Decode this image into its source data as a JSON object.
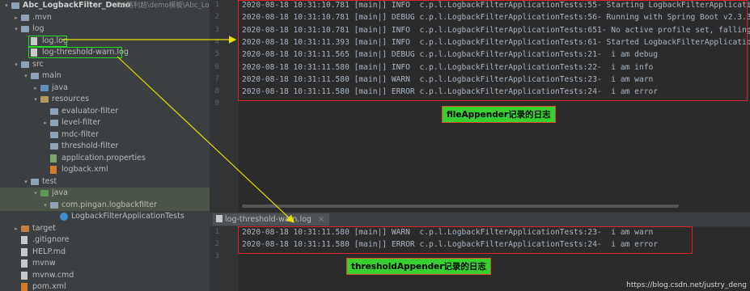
{
  "tree": {
    "items": [
      {
        "label": "Abc_LogbackFilter_Demo",
        "path": "D:\\路利超\\demo模板\\Abc_Lo",
        "bold": true,
        "depth": 0,
        "arrow": "▾",
        "icon": "folder"
      },
      {
        "label": ".mvn",
        "depth": 1,
        "arrow": "▸",
        "icon": "folder"
      },
      {
        "label": "log",
        "depth": 1,
        "arrow": "▾",
        "icon": "folder"
      },
      {
        "label": "log.log",
        "depth": 2,
        "arrow": "",
        "icon": "file",
        "boxed": true
      },
      {
        "label": "log-threshold-warn.log",
        "depth": 2,
        "arrow": "",
        "icon": "file",
        "boxed": true
      },
      {
        "label": "src",
        "depth": 1,
        "arrow": "▾",
        "icon": "folder"
      },
      {
        "label": "main",
        "depth": 2,
        "arrow": "▾",
        "icon": "folder"
      },
      {
        "label": "java",
        "depth": 3,
        "arrow": "▸",
        "icon": "folder-src"
      },
      {
        "label": "resources",
        "depth": 3,
        "arrow": "▾",
        "icon": "folder-res"
      },
      {
        "label": "evaluator-filter",
        "depth": 4,
        "arrow": "",
        "icon": "folder"
      },
      {
        "label": "level-filter",
        "depth": 4,
        "arrow": "▸",
        "icon": "folder"
      },
      {
        "label": "mdc-filter",
        "depth": 4,
        "arrow": "",
        "icon": "folder"
      },
      {
        "label": "threshold-filter",
        "depth": 4,
        "arrow": "",
        "icon": "folder"
      },
      {
        "label": "application.properties",
        "depth": 4,
        "arrow": "",
        "icon": "prop"
      },
      {
        "label": "logback.xml",
        "depth": 4,
        "arrow": "",
        "icon": "xml"
      },
      {
        "label": "test",
        "depth": 2,
        "arrow": "▾",
        "icon": "folder"
      },
      {
        "label": "java",
        "depth": 3,
        "arrow": "▾",
        "icon": "folder-test",
        "highlight": true
      },
      {
        "label": "com.pingan.logbackfilter",
        "depth": 4,
        "arrow": "▾",
        "icon": "folder",
        "highlight": true
      },
      {
        "label": "LogbackFilterApplicationTests",
        "depth": 5,
        "arrow": "",
        "icon": "class"
      },
      {
        "label": "target",
        "depth": 1,
        "arrow": "▸",
        "icon": "folder-excl"
      },
      {
        "label": ".gitignore",
        "depth": 1,
        "arrow": "",
        "icon": "file"
      },
      {
        "label": "HELP.md",
        "depth": 1,
        "arrow": "",
        "icon": "file"
      },
      {
        "label": "mvnw",
        "depth": 1,
        "arrow": "",
        "icon": "file"
      },
      {
        "label": "mvnw.cmd",
        "depth": 1,
        "arrow": "",
        "icon": "file"
      },
      {
        "label": "pom.xml",
        "depth": 1,
        "arrow": "",
        "icon": "xml"
      }
    ]
  },
  "log_main": {
    "lines": [
      {
        "num": "1",
        "text": "2020-08-18 10:31:10.781 [main|] INFO  c.p.l.LogbackFilterApplicationTests:55- Starting LogbackFilterApplicati"
      },
      {
        "num": "2",
        "text": "2020-08-18 10:31:10.781 [main|] DEBUG c.p.l.LogbackFilterApplicationTests:56- Running with Spring Boot v2.3.3"
      },
      {
        "num": "3",
        "text": "2020-08-18 10:31:10.781 [main|] INFO  c.p.l.LogbackFilterApplicationTests:651- No active profile set, falling"
      },
      {
        "num": "4",
        "text": "2020-08-18 10:31:11.393 [main|] INFO  c.p.l.LogbackFilterApplicationTests:61- Started LogbackFilterApplicatio"
      },
      {
        "num": "5",
        "text": "2020-08-18 10:31:11.565 [main|] DEBUG c.p.l.LogbackFilterApplicationTests:21-  i am debug"
      },
      {
        "num": "6",
        "text": "2020-08-18 10:31:11.580 [main|] INFO  c.p.l.LogbackFilterApplicationTests:22-  i am info"
      },
      {
        "num": "7",
        "text": "2020-08-18 10:31:11.580 [main|] WARN  c.p.l.LogbackFilterApplicationTests:23-  i am warn"
      },
      {
        "num": "8",
        "text": "2020-08-18 10:31:11.580 [main|] ERROR c.p.l.LogbackFilterApplicationTests:24-  i am error"
      },
      {
        "num": "9",
        "text": ""
      }
    ],
    "caption": "fileAppender记录的日志"
  },
  "tab": {
    "label": "log-threshold-warn.log",
    "close": "×"
  },
  "log_warn": {
    "lines": [
      {
        "num": "1",
        "text": "2020-08-18 10:31:11.580 [main|] WARN  c.p.l.LogbackFilterApplicationTests:23-  i am warn"
      },
      {
        "num": "2",
        "text": "2020-08-18 10:31:11.580 [main|] ERROR c.p.l.LogbackFilterApplicationTests:24-  i am error"
      },
      {
        "num": "3",
        "text": ""
      }
    ],
    "caption": "thresholdAppender记录的日志"
  },
  "watermark": "https://blog.csdn.net/justry_deng",
  "colors": {
    "annotation_box": "#e0202a",
    "highlight_box": "#22dd22",
    "caption_bg": "#36d12f",
    "arrow": "#e8e000"
  }
}
